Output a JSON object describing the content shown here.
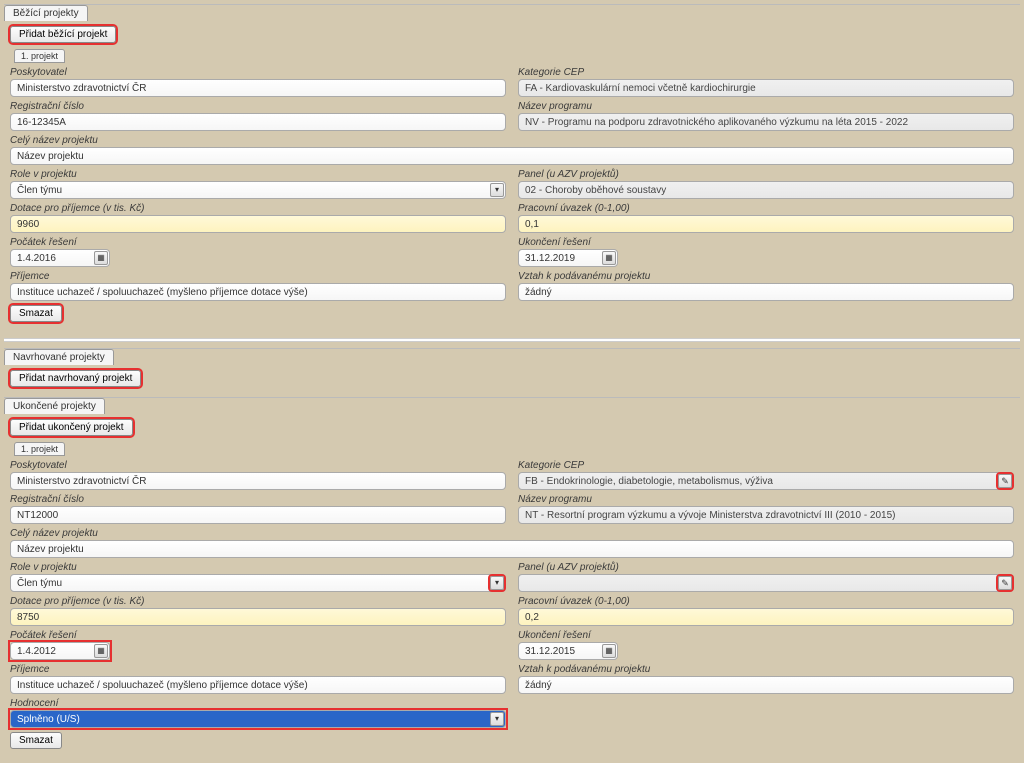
{
  "tabs": {
    "running": "Běžící projekty",
    "proposed": "Navrhované projekty",
    "finished": "Ukončené projekty"
  },
  "buttons": {
    "add_running": "Přidat běžící projekt",
    "add_proposed": "Přidat navrhovaný projekt",
    "add_finished": "Přidat ukončený projekt",
    "delete": "Smazat",
    "sub_tab": "1. projekt"
  },
  "labels": {
    "provider": "Poskytovatel",
    "cep_category": "Kategorie CEP",
    "program_name": "Název programu",
    "reg_number": "Registrační číslo",
    "full_name": "Celý název projektu",
    "role": "Role v projektu",
    "panel": "Panel (u AZV projektů)",
    "grant": "Dotace pro příjemce (v tis. Kč)",
    "workload": "Pracovní úvazek (0-1,00)",
    "start": "Počátek řešení",
    "end": "Ukončení řešení",
    "recipient": "Příjemce",
    "relation": "Vztah k podávanému projektu",
    "evaluation": "Hodnocení"
  },
  "running": {
    "provider": "Ministerstvo zdravotnictví ČR",
    "cep": "FA - Kardiovaskulární nemoci včetně kardiochirurgie",
    "program": "NV - Programu na podporu zdravotnického aplikovaného výzkumu na léta 2015 - 2022",
    "reg": "16-12345A",
    "name": "Název projektu",
    "role": "Člen týmu",
    "panel": "02 - Choroby oběhové soustavy",
    "grant": "9960",
    "workload": "0,1",
    "start": "1.4.2016",
    "end": "31.12.2019",
    "recipient": "Instituce uchazeč / spoluuchazeč (myšleno příjemce dotace výše)",
    "relation": "žádný"
  },
  "finished": {
    "provider": "Ministerstvo zdravotnictví ČR",
    "cep": "FB - Endokrinologie, diabetologie, metabolismus, výživa",
    "program": "NT - Resortní program výzkumu a vývoje Ministerstva zdravotnictví III  (2010 - 2015)",
    "reg": "NT12000",
    "name": "Název projektu",
    "role": "Člen týmu",
    "panel": "",
    "grant": "8750",
    "workload": "0,2",
    "start": "1.4.2012",
    "end": "31.12.2015",
    "recipient": "Instituce uchazeč / spoluuchazeč (myšleno příjemce dotace výše)",
    "relation": "žádný",
    "evaluation": "Splněno (U/S)"
  }
}
